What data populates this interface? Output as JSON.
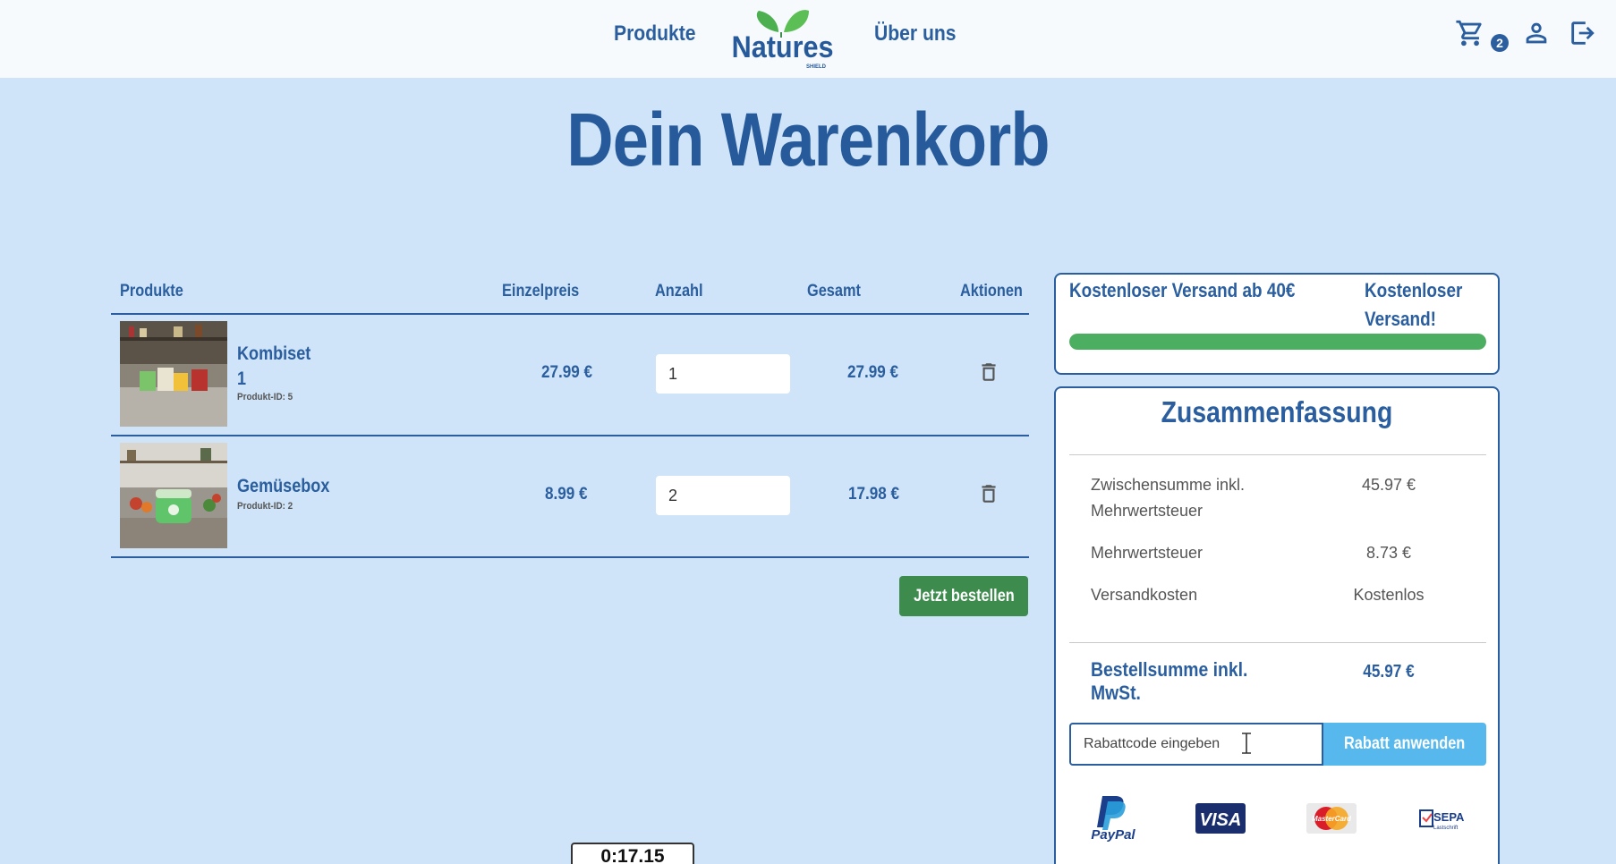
{
  "header": {
    "nav_products": "Produkte",
    "nav_about": "Über uns",
    "logo_text": "Natures",
    "logo_subtext": "SHIELD",
    "cart_count": "2",
    "icons": [
      "cart-icon",
      "user-icon",
      "logout-icon"
    ]
  },
  "page": {
    "title": "Dein Warenkorb"
  },
  "table": {
    "headers": {
      "product": "Produkte",
      "unit_price": "Einzelpreis",
      "quantity": "Anzahl",
      "total": "Gesamt",
      "actions": "Aktionen"
    },
    "rows": [
      {
        "name_line1": "Kombiset",
        "name_line2": "1",
        "product_id": "Produkt-ID: 5",
        "unit_price": "27.99 €",
        "quantity": "1",
        "total": "27.99 €"
      },
      {
        "name_line1": "Gemüsebox",
        "name_line2": "",
        "product_id": "Produkt-ID: 2",
        "unit_price": "8.99 €",
        "quantity": "2",
        "total": "17.98 €"
      }
    ],
    "order_button": "Jetzt bestellen"
  },
  "shipping": {
    "threshold_label": "Kostenloser Versand ab 40€",
    "status_label": "Kostenloser Versand!",
    "progress_fraction": 1.0,
    "bar_color": "#4cae61"
  },
  "summary": {
    "title": "Zusammenfassung",
    "subtotal_label": "Zwischensumme inkl. Mehrwertsteuer",
    "subtotal_value": "45.97 €",
    "vat_label": "Mehrwertsteuer",
    "vat_value": "8.73 €",
    "shipping_label": "Versandkosten",
    "shipping_value": "Kostenlos",
    "total_label": "Bestellsumme inkl. MwSt.",
    "total_value": "45.97 €",
    "coupon_placeholder": "Rabattcode eingeben",
    "coupon_button": "Rabatt anwenden",
    "payment_methods": [
      "PayPal",
      "VISA",
      "MasterCard",
      "SEPA"
    ],
    "sepa_sub": "Lastschrift"
  },
  "timer": "0:17.15",
  "colors": {
    "primary": "#2a5e9e",
    "background": "#cfe4f8",
    "order_button": "#3d8c4e",
    "coupon_button": "#57b8ee"
  }
}
